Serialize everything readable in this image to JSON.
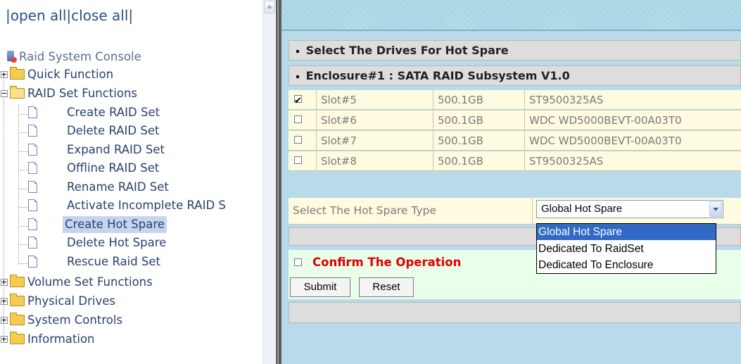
{
  "nav": {
    "open_all": "open all",
    "close_all": "close all",
    "sep1": "|",
    "sep2": "|",
    "sep3": "|"
  },
  "tree": {
    "root": "Raid System Console",
    "quick_function": "Quick Function",
    "raid_set_functions": "RAID Set Functions",
    "raid_items": [
      "Create RAID Set",
      "Delete RAID Set",
      "Expand RAID Set",
      "Offline RAID Set",
      "Rename RAID Set",
      "Activate Incomplete RAID S",
      "Create Hot Spare",
      "Delete Hot Spare",
      "Rescue Raid Set"
    ],
    "selected_item": "Create Hot Spare",
    "volume_set_functions": "Volume Set Functions",
    "physical_drives": "Physical Drives",
    "system_controls": "System Controls",
    "information": "Information"
  },
  "main": {
    "title": "Select The Drives For Hot Spare",
    "enclosure": "Enclosure#1 : SATA RAID Subsystem V1.0",
    "drives": [
      {
        "slot": "Slot#5",
        "size": "500.1GB",
        "model": "ST9500325AS",
        "checked": true
      },
      {
        "slot": "Slot#6",
        "size": "500.1GB",
        "model": "WDC WD5000BEVT-00A03T0",
        "checked": false
      },
      {
        "slot": "Slot#7",
        "size": "500.1GB",
        "model": "WDC WD5000BEVT-00A03T0",
        "checked": false
      },
      {
        "slot": "Slot#8",
        "size": "500.1GB",
        "model": "ST9500325AS",
        "checked": false
      }
    ],
    "hot_spare_type_label": "Select The Hot Spare Type",
    "hot_spare_type_value": "Global Hot Spare",
    "hot_spare_type_options": [
      "Global Hot Spare",
      "Dedicated To RaidSet",
      "Dedicated To Enclosure"
    ],
    "confirm_label": "Confirm The Operation",
    "submit_label": "Submit",
    "reset_label": "Reset"
  },
  "colors": {
    "accent_red": "#e00000",
    "highlight_blue": "#316ac5",
    "frame_blue": "#b9dbe9"
  }
}
